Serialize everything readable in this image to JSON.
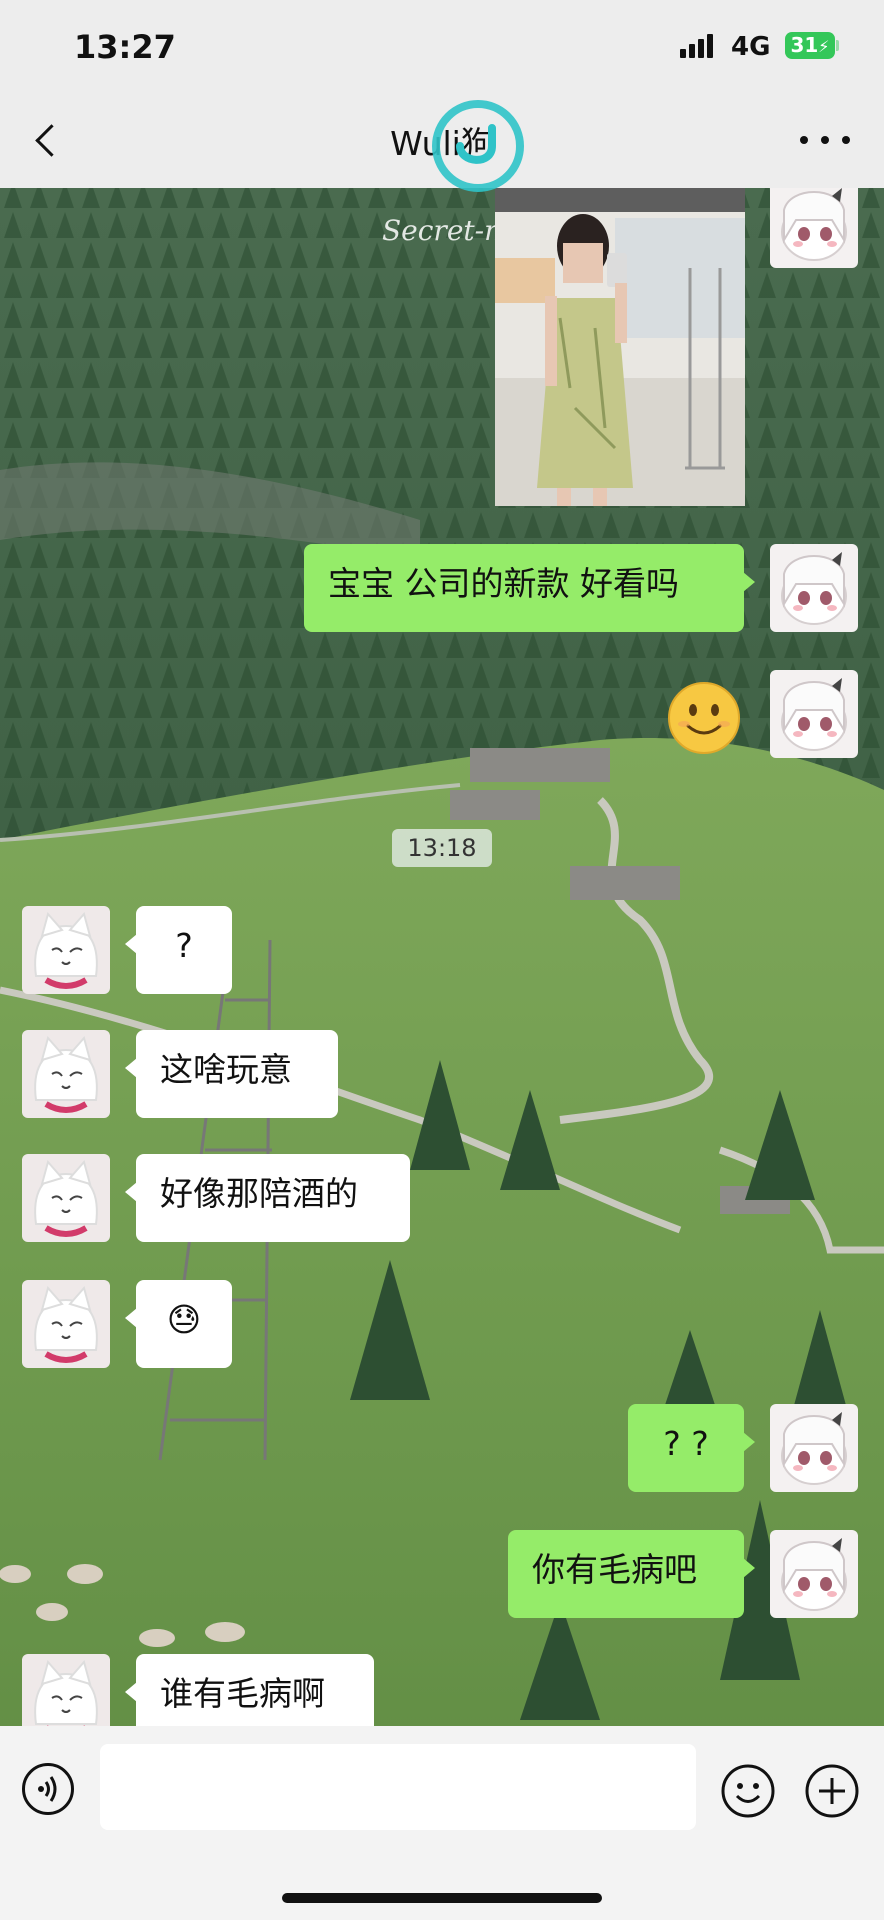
{
  "status_bar": {
    "time": "13:27",
    "network": "4G",
    "battery": "31"
  },
  "header": {
    "title": "Wuli狗"
  },
  "watermark": {
    "text": "Secret-me"
  },
  "messages": [
    {
      "id": 1,
      "sender": "me",
      "type": "image"
    },
    {
      "id": 2,
      "sender": "me",
      "type": "text",
      "text": "宝宝 公司的新款 好看吗"
    },
    {
      "id": 3,
      "sender": "me",
      "type": "emoji",
      "emoji": "slightly-smiling-face"
    },
    {
      "id": 4,
      "type": "timestamp",
      "text": "13:18"
    },
    {
      "id": 5,
      "sender": "other",
      "type": "text",
      "text": "?"
    },
    {
      "id": 6,
      "sender": "other",
      "type": "text",
      "text": "这啥玩意"
    },
    {
      "id": 7,
      "sender": "other",
      "type": "text",
      "text": "好像那陪酒的"
    },
    {
      "id": 8,
      "sender": "other",
      "type": "emoji",
      "text": "😓"
    },
    {
      "id": 9,
      "sender": "me",
      "type": "text",
      "text": "? ?"
    },
    {
      "id": 10,
      "sender": "me",
      "type": "text",
      "text": "你有毛病吧"
    },
    {
      "id": 11,
      "sender": "other",
      "type": "text",
      "text": "谁有毛病啊"
    }
  ],
  "input_bar": {
    "placeholder": ""
  },
  "colors": {
    "outgoing_bubble": "#95ec69",
    "incoming_bubble": "#ffffff",
    "battery": "#34c759"
  }
}
